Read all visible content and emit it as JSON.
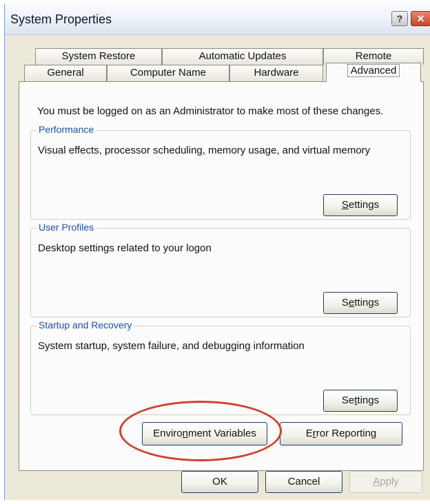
{
  "window": {
    "title": "System Properties",
    "help_glyph": "?",
    "close_glyph": "✕"
  },
  "tabs": {
    "row1": [
      {
        "label": "System Restore"
      },
      {
        "label": "Automatic Updates"
      },
      {
        "label": "Remote"
      }
    ],
    "row2": [
      {
        "label": "General"
      },
      {
        "label": "Computer Name"
      },
      {
        "label": "Hardware"
      },
      {
        "label": "Advanced",
        "selected": true
      }
    ]
  },
  "advanced": {
    "admin_notice": "You must be logged on as an Administrator to make most of these changes.",
    "performance": {
      "legend": "Performance",
      "description": "Visual effects, processor scheduling, memory usage, and virtual memory",
      "button_pre": "",
      "button_key": "S",
      "button_post": "ettings"
    },
    "user_profiles": {
      "legend": "User Profiles",
      "description": "Desktop settings related to your logon",
      "button_pre": "S",
      "button_key": "e",
      "button_post": "ttings"
    },
    "startup_recovery": {
      "legend": "Startup and Recovery",
      "description": "System startup, system failure, and debugging information",
      "button_pre": "Se",
      "button_key": "t",
      "button_post": "tings"
    },
    "env_button": {
      "pre": "Enviro",
      "key": "n",
      "post": "ment Variables"
    },
    "error_button": {
      "pre": "E",
      "key": "r",
      "post": "ror Reporting"
    }
  },
  "dialog_buttons": {
    "ok": "OK",
    "cancel": "Cancel",
    "apply_pre": "",
    "apply_key": "A",
    "apply_post": "pply"
  },
  "colors": {
    "highlight_ring": "#d2402c",
    "group_legend": "#1d4fa8"
  }
}
